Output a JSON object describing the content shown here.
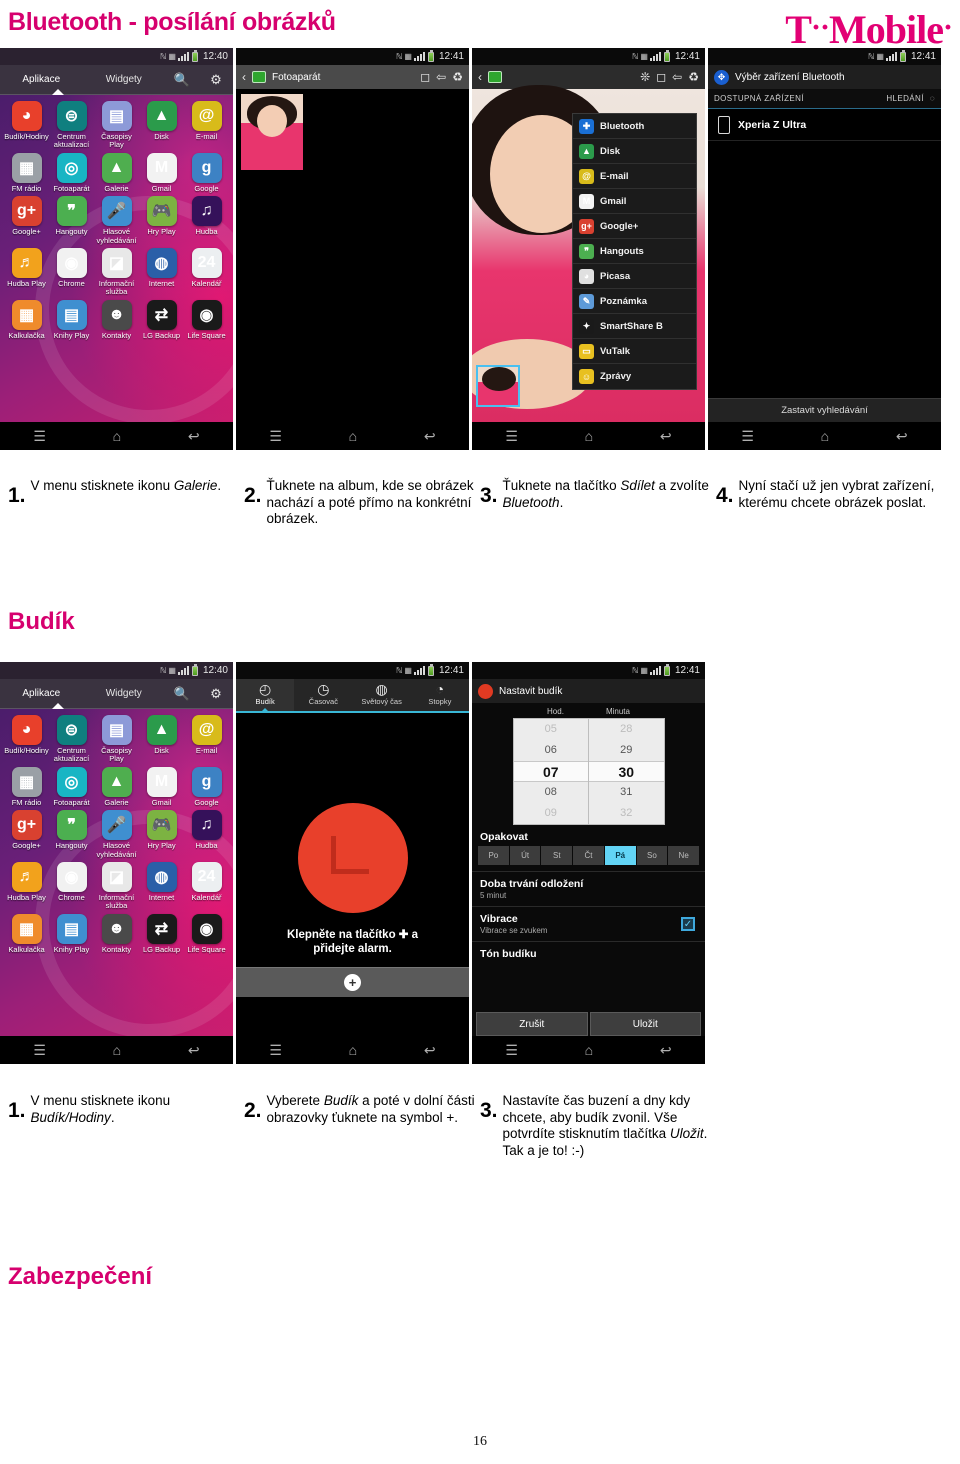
{
  "document": {
    "title": "Bluetooth - posílání obrázků",
    "brand": "T··Mobile·",
    "page_number": "16"
  },
  "sections": [
    {
      "heading": "Budík"
    },
    {
      "heading": "Zabezpečení"
    }
  ],
  "row1": {
    "steps": [
      {
        "num": "1.",
        "text": "V menu stisknete ikonu ",
        "em": "Galerie",
        "tail": "."
      },
      {
        "num": "2.",
        "text": "Ťuknete na album, kde se obrázek nachází a poté přímo na konkrétní obrázek.",
        "em": "",
        "tail": ""
      },
      {
        "num": "3.",
        "text": "Ťuknete na tlačítko ",
        "em": "Sdílet",
        "tail": " a zvolíte ",
        "em2": "Bluetooth",
        "tail2": "."
      },
      {
        "num": "4.",
        "text": "Nyní stačí už jen vybrat zařízení, kterému chcete obrázek poslat.",
        "em": "",
        "tail": ""
      }
    ]
  },
  "row2": {
    "steps": [
      {
        "num": "1.",
        "text": "V menu stisknete ikonu ",
        "em": "Budík/Hodiny",
        "tail": "."
      },
      {
        "num": "2.",
        "text": "Vyberete ",
        "em": "Budík",
        "tail": " a poté v dolní části obrazovky ťuknete na symbol +."
      },
      {
        "num": "3.",
        "text": "Nastavíte čas buzení a dny kdy chcete, aby budík zvonil. Vše potvrdíte stisknutím tlačítka ",
        "em": "Uložit",
        "tail": ". Tak a je to! :-)"
      }
    ]
  },
  "appdrawer": {
    "statusbar": {
      "time_1": "12:40",
      "time_2": "12:41"
    },
    "tabs": [
      {
        "label": "Aplikace",
        "active": true
      },
      {
        "label": "Widgety",
        "active": false
      }
    ],
    "icons": {
      "search": "search-icon",
      "settings": "gear-icon"
    },
    "apps": [
      {
        "label": "Budík/Hodiny",
        "glyph": "◕",
        "color": "#e8402b"
      },
      {
        "label": "Centrum aktualizací",
        "glyph": "⊜",
        "color": "#0f7f7f"
      },
      {
        "label": "Časopisy Play",
        "glyph": "▤",
        "color": "#8d9ad8"
      },
      {
        "label": "Disk",
        "glyph": "▲",
        "color": "#2b9b4b"
      },
      {
        "label": "E-mail",
        "glyph": "@",
        "color": "#d8bb1a"
      },
      {
        "label": "FM rádio",
        "glyph": "▦",
        "color": "#9aa0a6"
      },
      {
        "label": "Fotoaparát",
        "glyph": "◎",
        "color": "#18b5c4"
      },
      {
        "label": "Galerie",
        "glyph": "▲",
        "color": "#4fae4f"
      },
      {
        "label": "Gmail",
        "glyph": "M",
        "color": "#f2f2f2"
      },
      {
        "label": "Google",
        "glyph": "g",
        "color": "#3d82c4"
      },
      {
        "label": "Google+",
        "glyph": "g+",
        "color": "#d94130"
      },
      {
        "label": "Hangouty",
        "glyph": "❞",
        "color": "#4caf50"
      },
      {
        "label": "Hlasové vyhledávání",
        "glyph": "🎤",
        "color": "#3f8fd0"
      },
      {
        "label": "Hry Play",
        "glyph": "🎮",
        "color": "#7cb342"
      },
      {
        "label": "Hudba",
        "glyph": "♫",
        "color": "#35115a"
      },
      {
        "label": "Hudba Play",
        "glyph": "♬",
        "color": "#f2a21c"
      },
      {
        "label": "Chrome",
        "glyph": "◉",
        "color": "#f1f1f1"
      },
      {
        "label": "Informační služba",
        "glyph": "◪",
        "color": "#e8e8e8"
      },
      {
        "label": "Internet",
        "glyph": "◍",
        "color": "#2a5fa8"
      },
      {
        "label": "Kalendář",
        "glyph": "24",
        "color": "#eceff1"
      },
      {
        "label": "Kalkulačka",
        "glyph": "▦",
        "color": "#ef8b2c"
      },
      {
        "label": "Knihy Play",
        "glyph": "▤",
        "color": "#3f8fd0"
      },
      {
        "label": "Kontakty",
        "glyph": "☻",
        "color": "#4a4a4a"
      },
      {
        "label": "LG Backup",
        "glyph": "⇄",
        "color": "#1a1a1a"
      },
      {
        "label": "Life Square",
        "glyph": "◉",
        "color": "#1a1a1a"
      }
    ]
  },
  "gallery": {
    "actionbar_title": "Fotoaparát",
    "icons": [
      "camera-icon",
      "share-icon",
      "trash-icon"
    ],
    "back_icon": "back-chevron-icon"
  },
  "sharemenu": {
    "actionbar_icons": [
      "smartshare-icon",
      "camera-icon",
      "share-icon",
      "trash-icon"
    ],
    "items": [
      {
        "label": "Bluetooth",
        "glyph": "✚",
        "color": "#1a6fd4"
      },
      {
        "label": "Disk",
        "glyph": "▲",
        "color": "#2b9b4b"
      },
      {
        "label": "E-mail",
        "glyph": "@",
        "color": "#d8bb1a"
      },
      {
        "label": "Gmail",
        "glyph": "M",
        "color": "#f2f2f2"
      },
      {
        "label": "Google+",
        "glyph": "g+",
        "color": "#d94130"
      },
      {
        "label": "Hangouts",
        "glyph": "❞",
        "color": "#4caf50"
      },
      {
        "label": "Picasa",
        "glyph": "◕",
        "color": "#e0e0e0"
      },
      {
        "label": "Poznámka",
        "glyph": "✎",
        "color": "#5d9ad8"
      },
      {
        "label": "SmartShare B",
        "glyph": "✦",
        "color": "#1a1a1a"
      },
      {
        "label": "VuTalk",
        "glyph": "▭",
        "color": "#e8c020"
      },
      {
        "label": "Zprávy",
        "glyph": "☺",
        "color": "#e8c020"
      }
    ]
  },
  "bluetooth_picker": {
    "title": "Výběr zařízení Bluetooth",
    "subheader_left": "DOSTUPNÁ ZAŘÍZENÍ",
    "subheader_right": "HLEDÁNÍ",
    "spinner_icon": "loading-spinner-icon",
    "devices": [
      {
        "name": "Xperia Z Ultra",
        "icon": "phone-icon"
      }
    ],
    "stop_button": "Zastavit vyhledávání"
  },
  "clock_app": {
    "tabs": [
      {
        "label": "Budík",
        "glyph": "◴",
        "active": true
      },
      {
        "label": "Časovač",
        "glyph": "◷",
        "active": false
      },
      {
        "label": "Světový čas",
        "glyph": "◍",
        "active": false
      },
      {
        "label": "Stopky",
        "glyph": "◔",
        "active": false
      }
    ],
    "hint_line1": "Klepněte na tlačítko ✚ a",
    "hint_line2": "přidejte alarm.",
    "add_button": "+"
  },
  "alarm_settings": {
    "title": "Nastavit budík",
    "picker": {
      "hour_label": "Hod.",
      "minute_label": "Minuta",
      "hours": [
        "05",
        "06",
        "07",
        "08",
        "09"
      ],
      "minutes": [
        "28",
        "29",
        "30",
        "31",
        "32"
      ],
      "selected_hour": "07",
      "selected_minute": "30"
    },
    "repeat_label": "Opakovat",
    "days": [
      {
        "label": "Po",
        "on": false
      },
      {
        "label": "Út",
        "on": false
      },
      {
        "label": "St",
        "on": false
      },
      {
        "label": "Čt",
        "on": false
      },
      {
        "label": "Pá",
        "on": true
      },
      {
        "label": "So",
        "on": false
      },
      {
        "label": "Ne",
        "on": false
      }
    ],
    "snooze_title": "Doba trvání odložení",
    "snooze_value": "5 minut",
    "vibrate_title": "Vibrace",
    "vibrate_sub": "Vibrace se zvukem",
    "vibrate_checked": true,
    "tone_title": "Tón budíku",
    "cancel_button": "Zrušit",
    "save_button": "Uložit"
  },
  "colors": {
    "brand_magenta": "#e20074",
    "heading_pink": "#d6006e",
    "accent_blue": "#39b7d6"
  }
}
